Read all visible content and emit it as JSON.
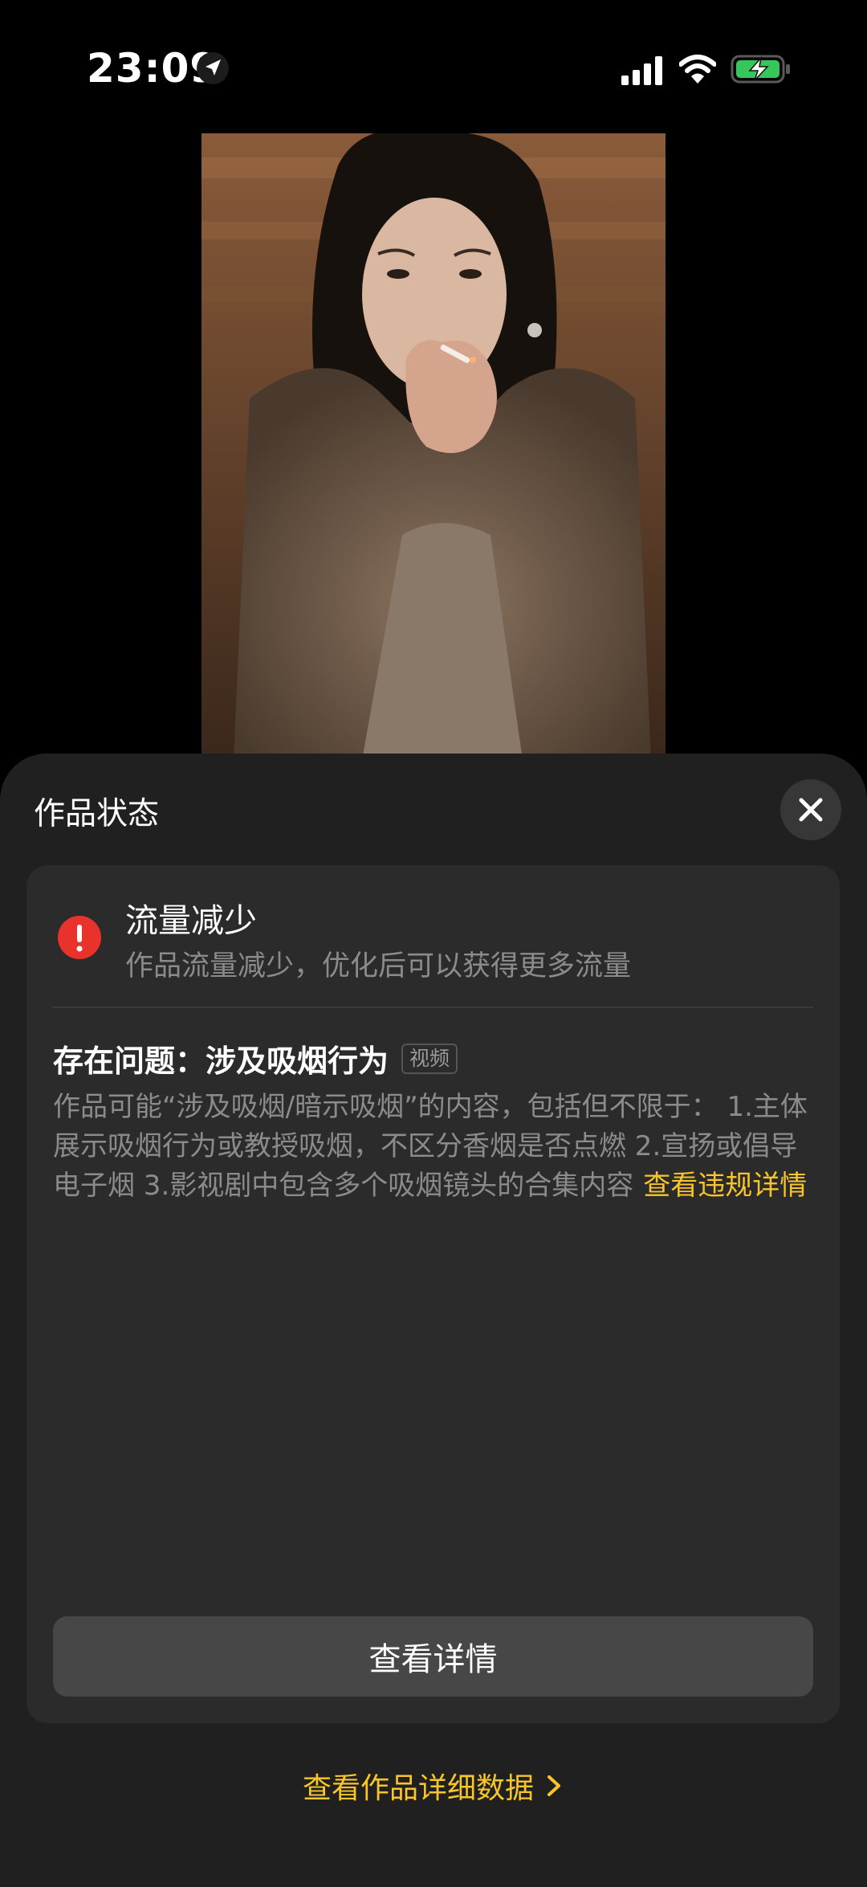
{
  "status_bar": {
    "time": "23:09"
  },
  "icons": {
    "location": "location-arrow-icon",
    "signal": "cellular-signal-icon",
    "wifi": "wifi-icon",
    "battery": "battery-charging-icon",
    "close": "close-icon",
    "alert": "exclamation-icon",
    "chevron": "chevron-right-icon"
  },
  "colors": {
    "accent": "#f8c52a",
    "alert": "#e8322b",
    "battery": "#35c759"
  },
  "sheet": {
    "title": "作品状态",
    "status_title": "流量减少",
    "status_desc": "作品流量减少，优化后可以获得更多流量",
    "issue_title": "存在问题：涉及吸烟行为",
    "issue_tag": "视频",
    "issue_body": "作品可能“涉及吸烟/暗示吸烟”的内容，包括但不限于： 1.主体展示吸烟行为或教授吸烟，不区分香烟是否点燃 2.宣扬或倡导电子烟 3.影视剧中包含多个吸烟镜头的合集内容",
    "violation_link": "查看违规详情",
    "detail_button": "查看详情",
    "data_link": "查看作品详细数据"
  }
}
